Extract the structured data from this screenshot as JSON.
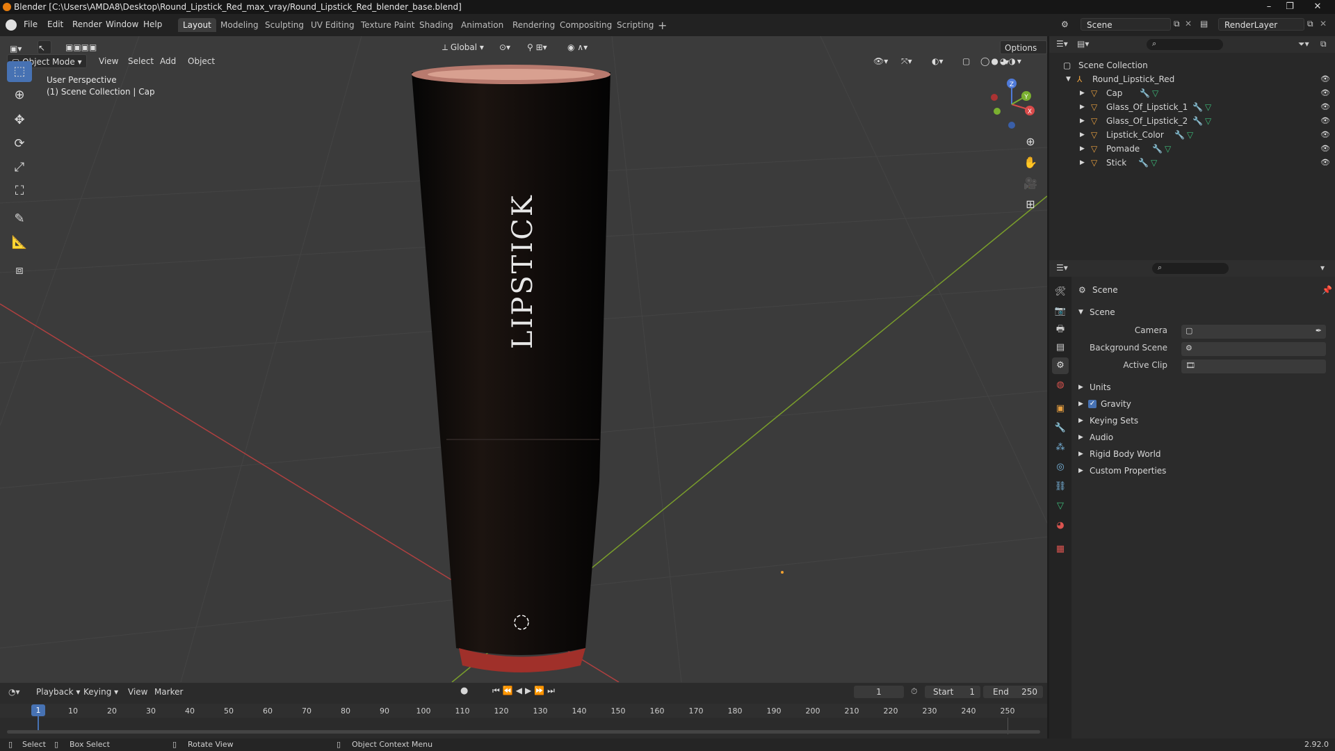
{
  "titlebar": {
    "title": "Blender [C:\\Users\\AMDA8\\Desktop\\Round_Lipstick_Red_max_vray/Round_Lipstick_Red_blender_base.blend]"
  },
  "menu": [
    "File",
    "Edit",
    "Render",
    "Window",
    "Help"
  ],
  "workspaces": [
    "Layout",
    "Modeling",
    "Sculpting",
    "UV Editing",
    "Texture Paint",
    "Shading",
    "Animation",
    "Rendering",
    "Compositing",
    "Scripting"
  ],
  "scene_field": "Scene",
  "renderlayer_field": "RenderLayer",
  "viewport": {
    "mode": "Object Mode",
    "menus": [
      "View",
      "Select",
      "Add",
      "Object"
    ],
    "transform": "Global",
    "options": "Options",
    "overlay_line1": "User Perspective",
    "overlay_line2": "(1) Scene Collection | Cap",
    "model_text": "LIPSTICK",
    "gizmo": {
      "x": "X",
      "y": "Y",
      "z": "Z"
    },
    "accent_color": "#4772b3"
  },
  "outliner": {
    "root": "Scene Collection",
    "collection": "Round_Lipstick_Red",
    "objects": [
      "Cap",
      "Glass_Of_Lipstick_1",
      "Glass_Of_Lipstick_2",
      "Lipstick_Color",
      "Pomade",
      "Stick"
    ]
  },
  "properties": {
    "context": "Scene",
    "panel_title": "Scene",
    "fields": [
      {
        "label": "Camera",
        "value": ""
      },
      {
        "label": "Background Scene",
        "value": ""
      },
      {
        "label": "Active Clip",
        "value": ""
      }
    ],
    "subpanels": [
      "Units",
      "Gravity",
      "Keying Sets",
      "Audio",
      "Rigid Body World",
      "Custom Properties"
    ],
    "gravity_checked": true
  },
  "timeline": {
    "menus": [
      "Playback",
      "Keying",
      "View",
      "Marker"
    ],
    "current_frame": "1",
    "start_label": "Start",
    "start": "1",
    "end_label": "End",
    "end": "250",
    "ticks": [
      "1",
      "10",
      "20",
      "30",
      "40",
      "50",
      "60",
      "70",
      "80",
      "90",
      "100",
      "110",
      "120",
      "130",
      "140",
      "150",
      "160",
      "170",
      "180",
      "190",
      "200",
      "210",
      "220",
      "230",
      "240",
      "250"
    ]
  },
  "status": {
    "select": "Select",
    "box_select": "Box Select",
    "rotate_view": "Rotate View",
    "context_menu": "Object Context Menu",
    "version": "2.92.0"
  }
}
